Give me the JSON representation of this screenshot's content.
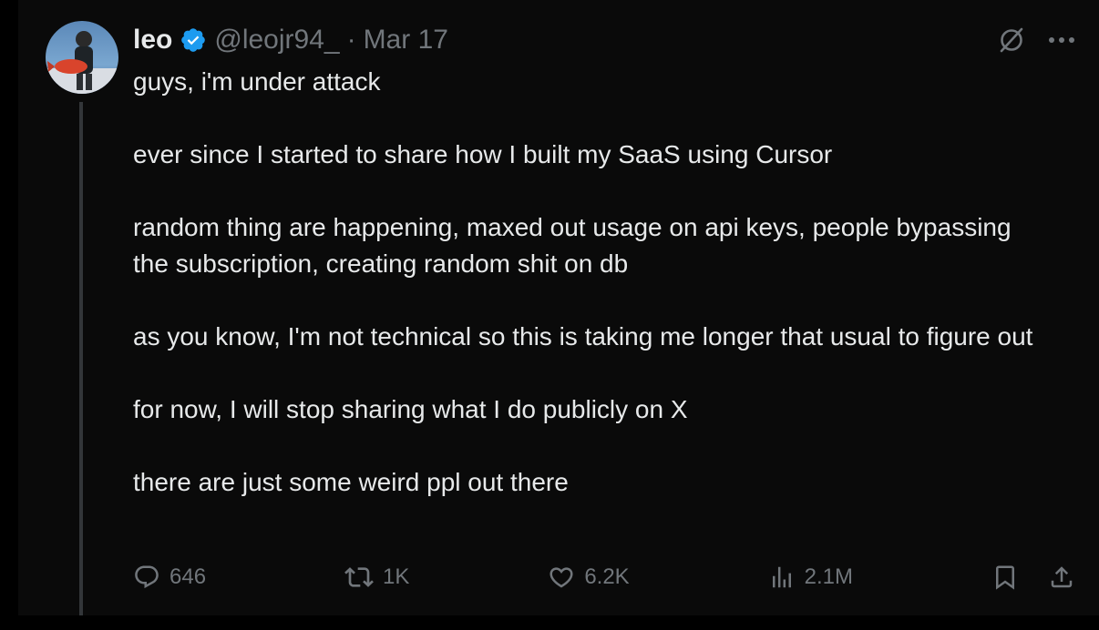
{
  "tweet": {
    "author": {
      "name": "leo",
      "handle": "@leojr94_",
      "verified": true,
      "avatar_icon": "avatar-person-with-fish"
    },
    "separator": "·",
    "date": "Mar 17",
    "paragraphs": [
      "guys, i'm under attack",
      "ever since I started to share how I built my SaaS using Cursor",
      "random thing are happening, maxed out usage on api keys, people bypassing the subscription, creating random shit on db",
      "as you know, I'm not technical so this is taking me longer that usual to figure out",
      "for now, I will stop sharing what I do publicly on X",
      "there are just some weird ppl out there"
    ],
    "stats": {
      "replies": "646",
      "reposts": "1K",
      "likes": "6.2K",
      "views": "2.1M"
    },
    "top_icons": [
      "grok-slash-icon",
      "more-icon"
    ]
  },
  "colors": {
    "background": "#0a0a0a",
    "text": "#e7e9ea",
    "muted": "#71767b",
    "verified": "#1d9bf0",
    "thread_line": "#333639"
  }
}
